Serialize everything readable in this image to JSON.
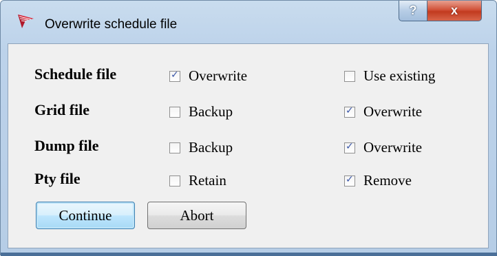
{
  "window": {
    "title": "Overwrite schedule file",
    "help_label": "?",
    "close_label": "x"
  },
  "rows": [
    {
      "label": "Schedule file",
      "option1": {
        "label": "Overwrite",
        "checked": true
      },
      "option2": {
        "label": "Use existing",
        "checked": false
      }
    },
    {
      "label": "Grid file",
      "option1": {
        "label": "Backup",
        "checked": false
      },
      "option2": {
        "label": "Overwrite",
        "checked": true
      }
    },
    {
      "label": "Dump file",
      "option1": {
        "label": "Backup",
        "checked": false
      },
      "option2": {
        "label": "Overwrite",
        "checked": true
      }
    },
    {
      "label": "Pty file",
      "option1": {
        "label": "Retain",
        "checked": false
      },
      "option2": {
        "label": "Remove",
        "checked": true
      }
    }
  ],
  "buttons": {
    "continue_label": "Continue",
    "abort_label": "Abort"
  }
}
